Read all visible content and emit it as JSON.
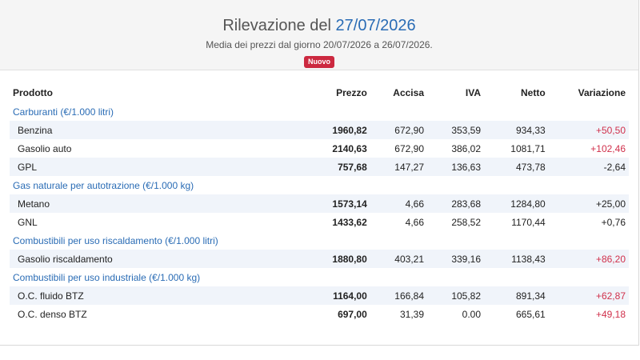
{
  "header": {
    "title_prefix": "Rilevazione del ",
    "title_date": "27/07/2026",
    "subtitle": "Media dei prezzi dal giorno 20/07/2026 a 26/07/2026.",
    "badge": "Nuovo"
  },
  "table": {
    "columns": [
      "Prodotto",
      "Prezzo",
      "Accisa",
      "IVA",
      "Netto",
      "Variazione"
    ],
    "categories": [
      {
        "label": "Carburanti (€/1.000 litri)",
        "rows": [
          {
            "name": "Benzina",
            "prezzo": "1960,82",
            "accisa": "672,90",
            "iva": "353,59",
            "netto": "934,33",
            "variazione": "+50,50",
            "trend": "up"
          },
          {
            "name": "Gasolio auto",
            "prezzo": "2140,63",
            "accisa": "672,90",
            "iva": "386,02",
            "netto": "1081,71",
            "variazione": "+102,46",
            "trend": "up"
          },
          {
            "name": "GPL",
            "prezzo": "757,68",
            "accisa": "147,27",
            "iva": "136,63",
            "netto": "473,78",
            "variazione": "-2,64",
            "trend": "down"
          }
        ]
      },
      {
        "label": "Gas naturale per autotrazione (€/1.000 kg)",
        "rows": [
          {
            "name": "Metano",
            "prezzo": "1573,14",
            "accisa": "4,66",
            "iva": "283,68",
            "netto": "1284,80",
            "variazione": "+25,00",
            "trend": "flat"
          },
          {
            "name": "GNL",
            "prezzo": "1433,62",
            "accisa": "4,66",
            "iva": "258,52",
            "netto": "1170,44",
            "variazione": "+0,76",
            "trend": "flat"
          }
        ]
      },
      {
        "label": "Combustibili per uso riscaldamento (€/1.000 litri)",
        "rows": [
          {
            "name": "Gasolio riscaldamento",
            "prezzo": "1880,80",
            "accisa": "403,21",
            "iva": "339,16",
            "netto": "1138,43",
            "variazione": "+86,20",
            "trend": "up"
          }
        ]
      },
      {
        "label": "Combustibili per uso industriale (€/1.000 kg)",
        "rows": [
          {
            "name": "O.C. fluido BTZ",
            "prezzo": "1164,00",
            "accisa": "166,84",
            "iva": "105,82",
            "netto": "891,34",
            "variazione": "+62,87",
            "trend": "up"
          },
          {
            "name": "O.C. denso BTZ",
            "prezzo": "697,00",
            "accisa": "31,39",
            "iva": "0.00",
            "netto": "665,61",
            "variazione": "+49,18",
            "trend": "up"
          }
        ]
      }
    ]
  },
  "colors": {
    "accent_blue": "#2a6cb5",
    "increase_red": "#d0304b",
    "badge_red": "#cc2940",
    "row_stripe": "#f0f4fa"
  }
}
